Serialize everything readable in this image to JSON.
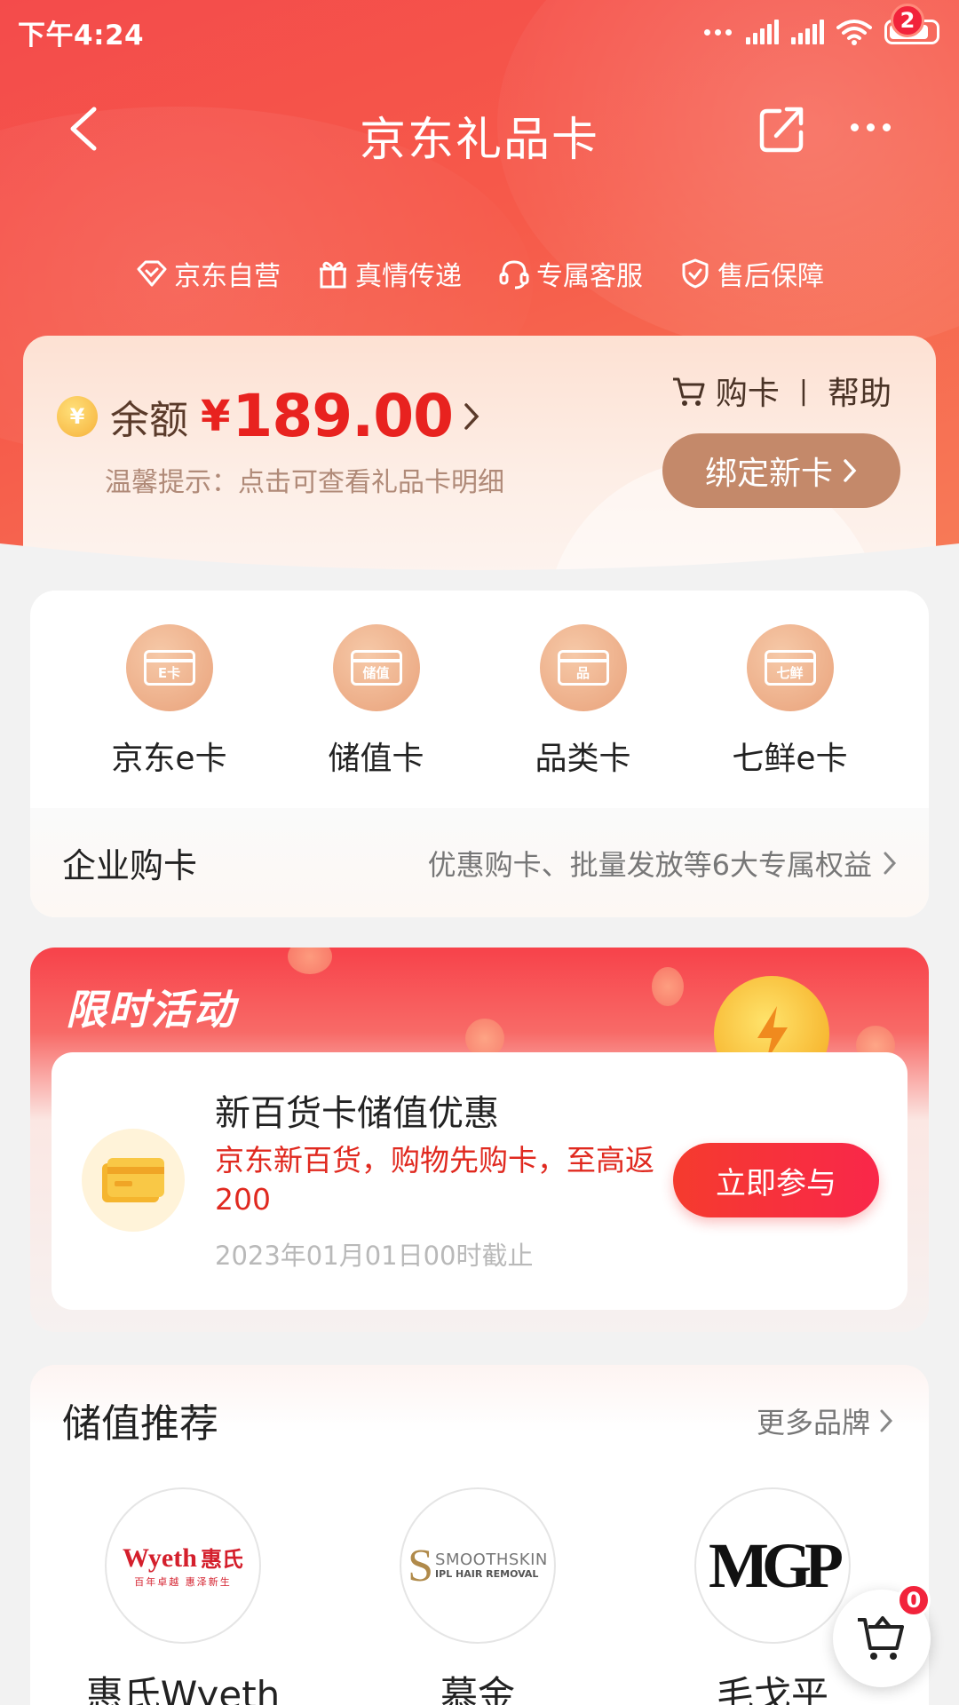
{
  "status_bar": {
    "time": "下午4:24"
  },
  "nav": {
    "title": "京东礼品卡",
    "badge_count": "2"
  },
  "features": [
    {
      "label": "京东自营",
      "icon": "diamond-check-icon"
    },
    {
      "label": "真情传递",
      "icon": "gift-icon"
    },
    {
      "label": "专属客服",
      "icon": "headset-icon"
    },
    {
      "label": "售后保障",
      "icon": "shield-check-icon"
    }
  ],
  "balance": {
    "coin_symbol": "¥",
    "label": "余额",
    "currency": "¥",
    "value": "189.00",
    "tip": "温馨提示：点击可查看礼品卡明细",
    "buy_label": "购卡",
    "separator": "|",
    "help_label": "帮助",
    "bind_label": "绑定新卡"
  },
  "card_types": [
    {
      "label": "京东e卡",
      "icon_text": "E卡"
    },
    {
      "label": "储值卡",
      "icon_text": "储值"
    },
    {
      "label": "品类卡",
      "icon_text": "品"
    },
    {
      "label": "七鲜e卡",
      "icon_text": "七鲜"
    }
  ],
  "enterprise": {
    "title": "企业购卡",
    "desc": "优惠购卡、批量发放等6大专属权益"
  },
  "activity": {
    "title": "限时活动",
    "name": "新百货卡储值优惠",
    "desc": "京东新百货，购物先购卡，至高返200",
    "date": "2023年01月01日00时截止",
    "button": "立即参与"
  },
  "recommend": {
    "title": "储值推荐",
    "more": "更多品牌",
    "brands": [
      {
        "name": "惠氏Wyeth",
        "logo_main": "Wyeth",
        "logo_cn": "惠氏",
        "logo_sub": "百年卓越 惠泽新生"
      },
      {
        "name": "慕金",
        "logo_main": "SMOOTHSKIN",
        "logo_sub": "IPL HAIR REMOVAL"
      },
      {
        "name": "毛戈平",
        "logo_main": "MGP"
      }
    ]
  },
  "cart": {
    "count": "0"
  },
  "colors": {
    "brand_red": "#f44b4b",
    "price_red": "#e8221f",
    "bind_btn": "#c4896a"
  }
}
